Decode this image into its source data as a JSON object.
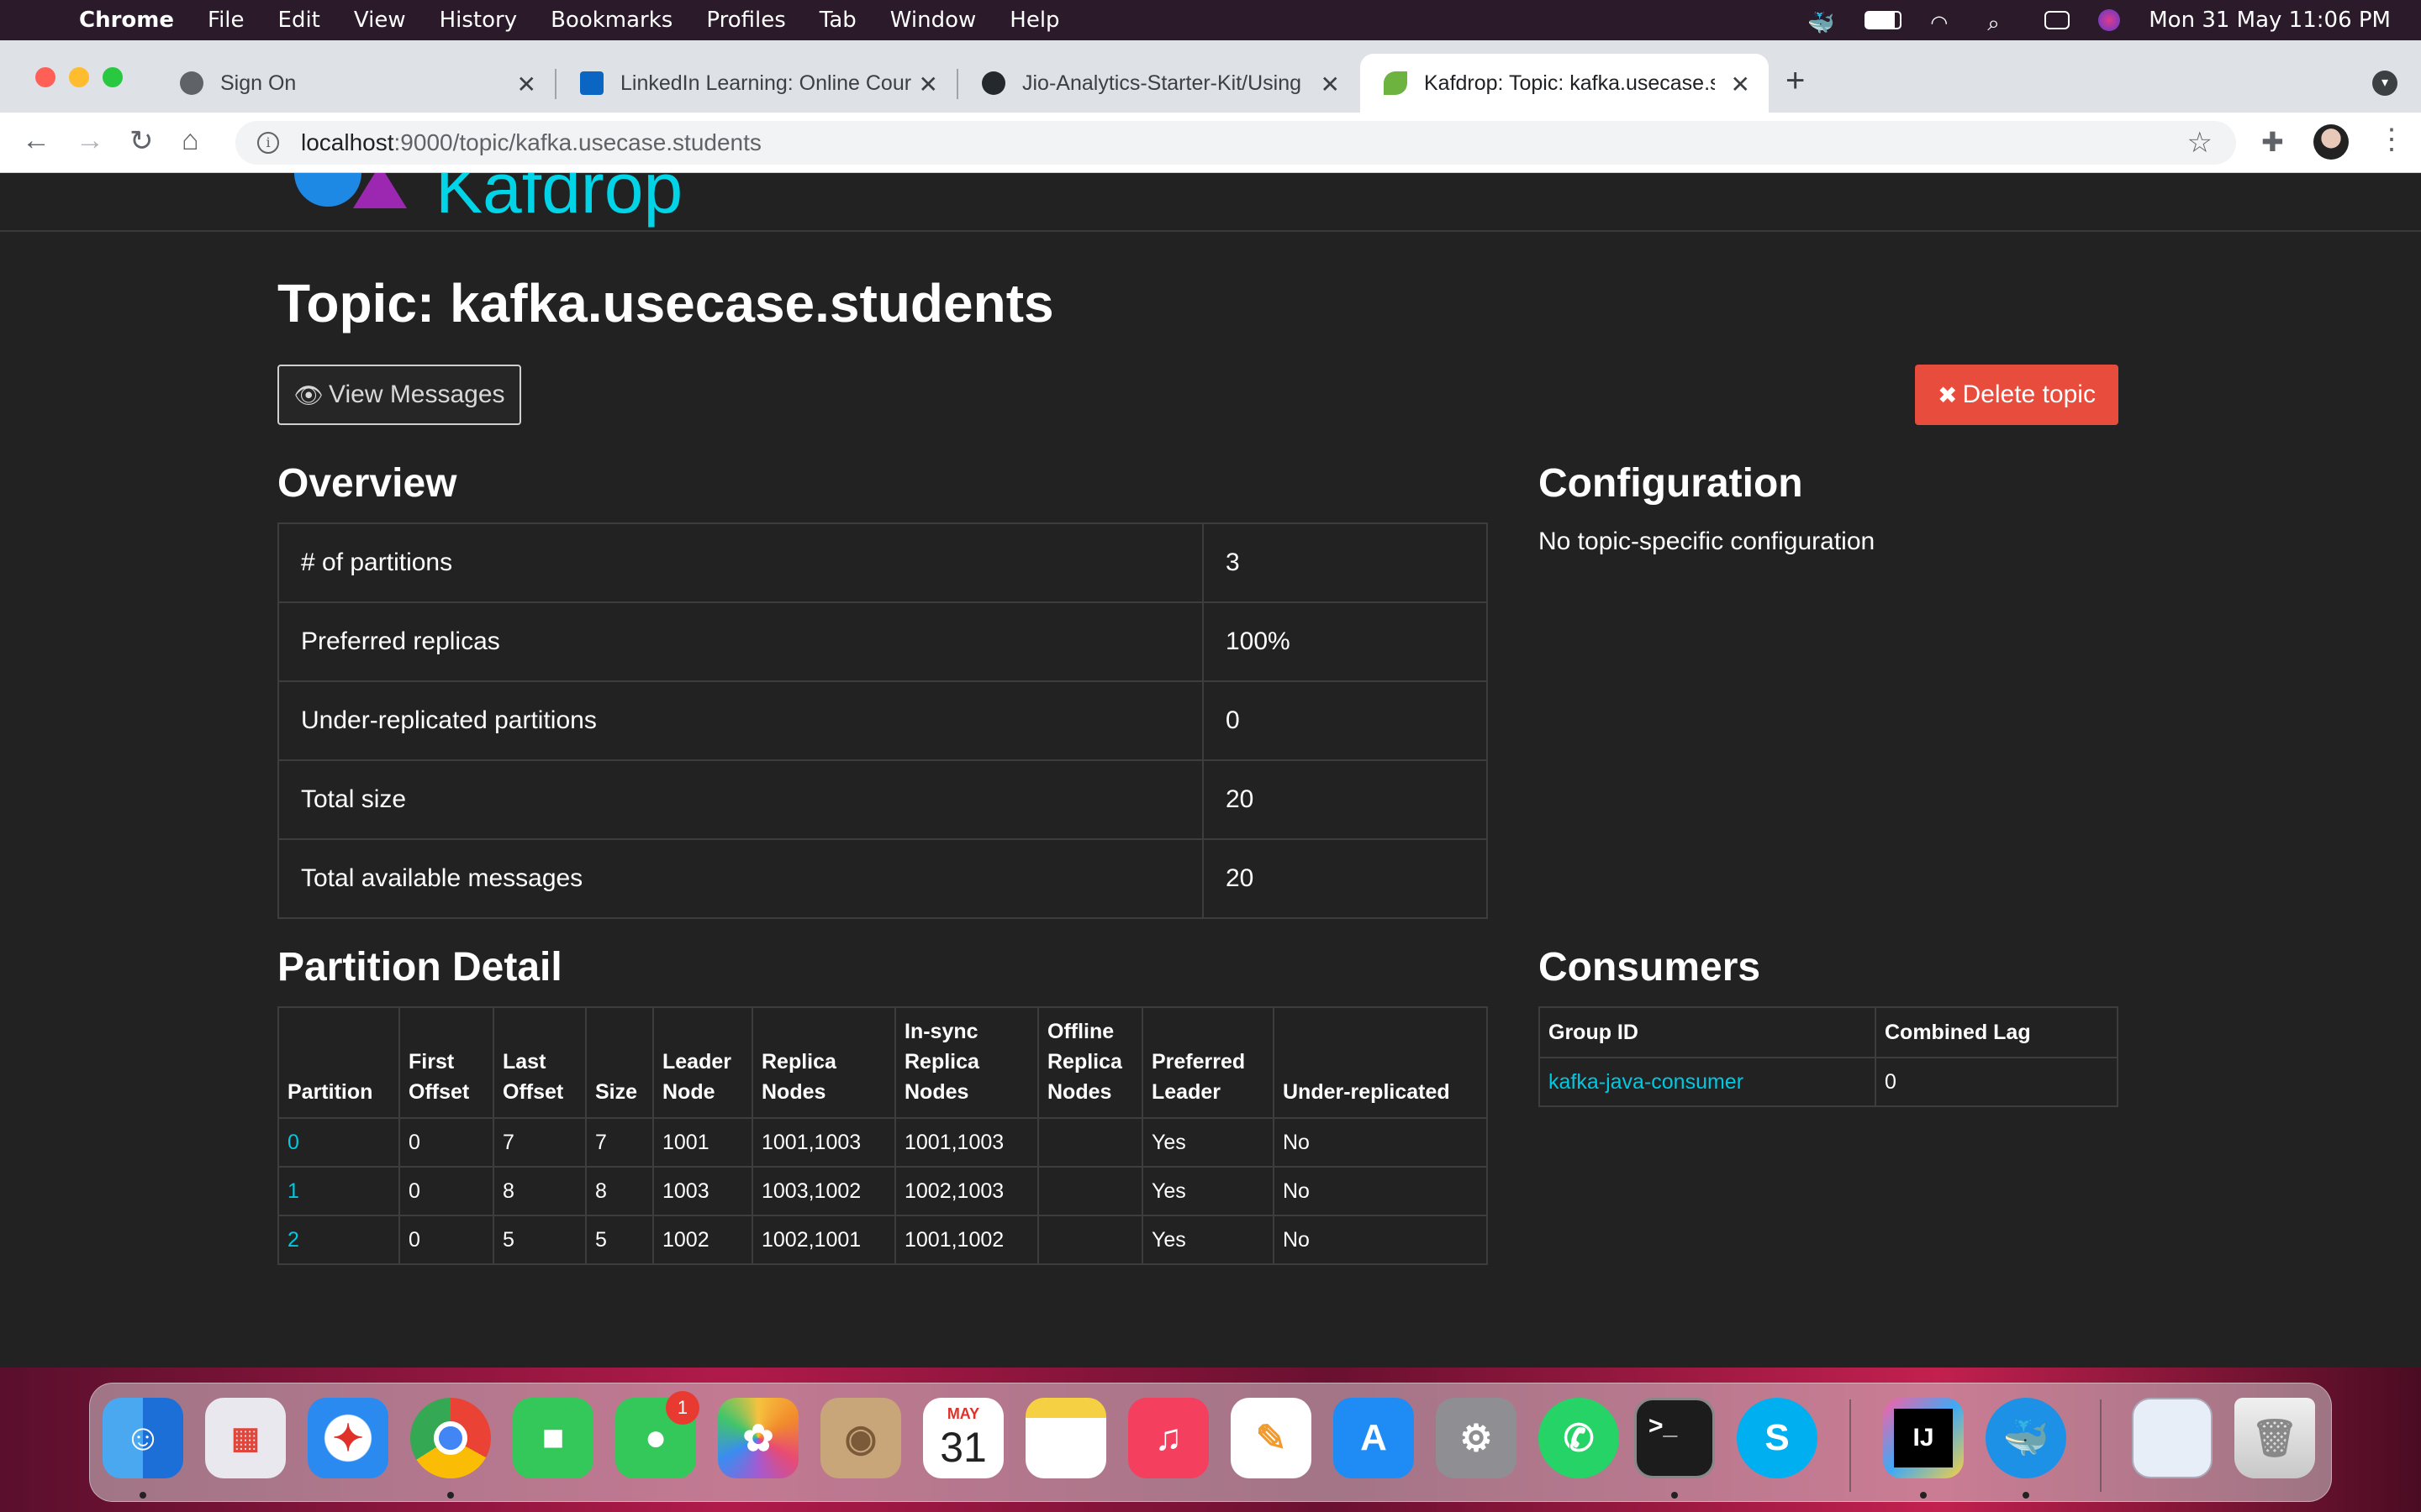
{
  "menubar": {
    "app": "Chrome",
    "items": [
      "File",
      "Edit",
      "View",
      "History",
      "Bookmarks",
      "Profiles",
      "Tab",
      "Window",
      "Help"
    ],
    "clock": "Mon 31 May  11:06 PM"
  },
  "tabs": [
    {
      "title": "Sign On"
    },
    {
      "title": "LinkedIn Learning: Online Cour"
    },
    {
      "title": "Jio-Analytics-Starter-Kit/Using"
    },
    {
      "title": "Kafdrop: Topic: kafka.usecase.s"
    }
  ],
  "omnibox": {
    "host": "localhost",
    "rest": ":9000/topic/kafka.usecase.students"
  },
  "brand": {
    "name": "Kafdrop"
  },
  "page": {
    "title": "Topic: kafka.usecase.students",
    "view_messages": "View Messages",
    "delete_topic": "Delete topic"
  },
  "overview": {
    "title": "Overview",
    "rows": [
      {
        "label": "# of partitions",
        "value": "3"
      },
      {
        "label": "Preferred replicas",
        "value": "100%"
      },
      {
        "label": "Under-replicated partitions",
        "value": "0"
      },
      {
        "label": "Total size",
        "value": "20"
      },
      {
        "label": "Total available messages",
        "value": "20"
      }
    ]
  },
  "configuration": {
    "title": "Configuration",
    "text": "No topic-specific configuration"
  },
  "partition_detail": {
    "title": "Partition Detail",
    "headers": [
      "Partition",
      "First Offset",
      "Last Offset",
      "Size",
      "Leader Node",
      "Replica Nodes",
      "In-sync Replica Nodes",
      "Offline Replica Nodes",
      "Preferred Leader",
      "Under-replicated"
    ],
    "rows": [
      [
        "0",
        "0",
        "7",
        "7",
        "1001",
        "1001,1003",
        "1001,1003",
        "",
        "Yes",
        "No"
      ],
      [
        "1",
        "0",
        "8",
        "8",
        "1003",
        "1003,1002",
        "1002,1003",
        "",
        "Yes",
        "No"
      ],
      [
        "2",
        "0",
        "5",
        "5",
        "1002",
        "1002,1001",
        "1001,1002",
        "",
        "Yes",
        "No"
      ]
    ]
  },
  "consumers": {
    "title": "Consumers",
    "headers": [
      "Group ID",
      "Combined Lag"
    ],
    "rows": [
      [
        "kafka-java-consumer",
        "0"
      ]
    ]
  },
  "dock": {
    "messages_badge": "1",
    "calendar_month": "MAY",
    "calendar_day": "31",
    "intellij_label": "IJ",
    "skype_label": "S"
  }
}
